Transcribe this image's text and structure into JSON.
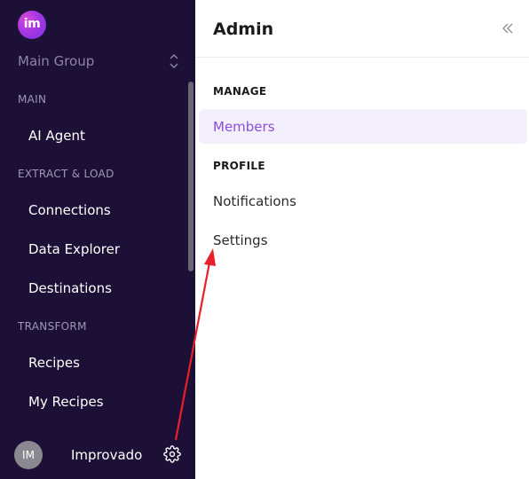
{
  "sidebar": {
    "logo_text": "im",
    "group_switcher": "Main Group",
    "sections": {
      "main": "MAIN",
      "extract_load": "EXTRACT & LOAD",
      "transform": "TRANSFORM"
    },
    "items": {
      "ai_agent": "AI Agent",
      "connections": "Connections",
      "data_explorer": "Data Explorer",
      "destinations": "Destinations",
      "recipes": "Recipes",
      "my_recipes": "My Recipes"
    },
    "user": {
      "initials": "IM",
      "name": "Improvado"
    },
    "icons": {
      "switcher": "chevron-up-down-icon",
      "settings": "gear-icon"
    }
  },
  "panel": {
    "title": "Admin",
    "collapse_icon": "double-chevron-left-icon",
    "sections": {
      "manage": "MANAGE",
      "profile": "PROFILE"
    },
    "items": {
      "members": "Members",
      "notifications": "Notifications",
      "settings": "Settings"
    },
    "active_item": "Members"
  },
  "colors": {
    "sidebar_bg": "#1c1037",
    "accent": "#8a4ddc",
    "active_bg": "#f4effd",
    "annotation": "#e8202a"
  }
}
